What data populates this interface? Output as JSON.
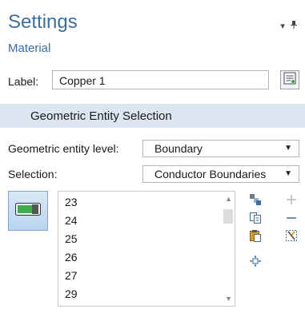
{
  "header": {
    "title": "Settings",
    "subtitle": "Material",
    "menu_glyph": "▾",
    "pin_glyph": "⯀"
  },
  "label_row": {
    "label": "Label:",
    "value": "Copper 1"
  },
  "section": {
    "title": "Geometric Entity Selection"
  },
  "entity_level": {
    "label": "Geometric entity level:",
    "value": "Boundary"
  },
  "selection": {
    "label": "Selection:",
    "value": "Conductor Boundaries"
  },
  "list": {
    "items": [
      "23",
      "24",
      "25",
      "26",
      "27",
      "29"
    ]
  },
  "colors": {
    "accent": "#3a6ea5",
    "section_bg": "#dde6f0"
  }
}
